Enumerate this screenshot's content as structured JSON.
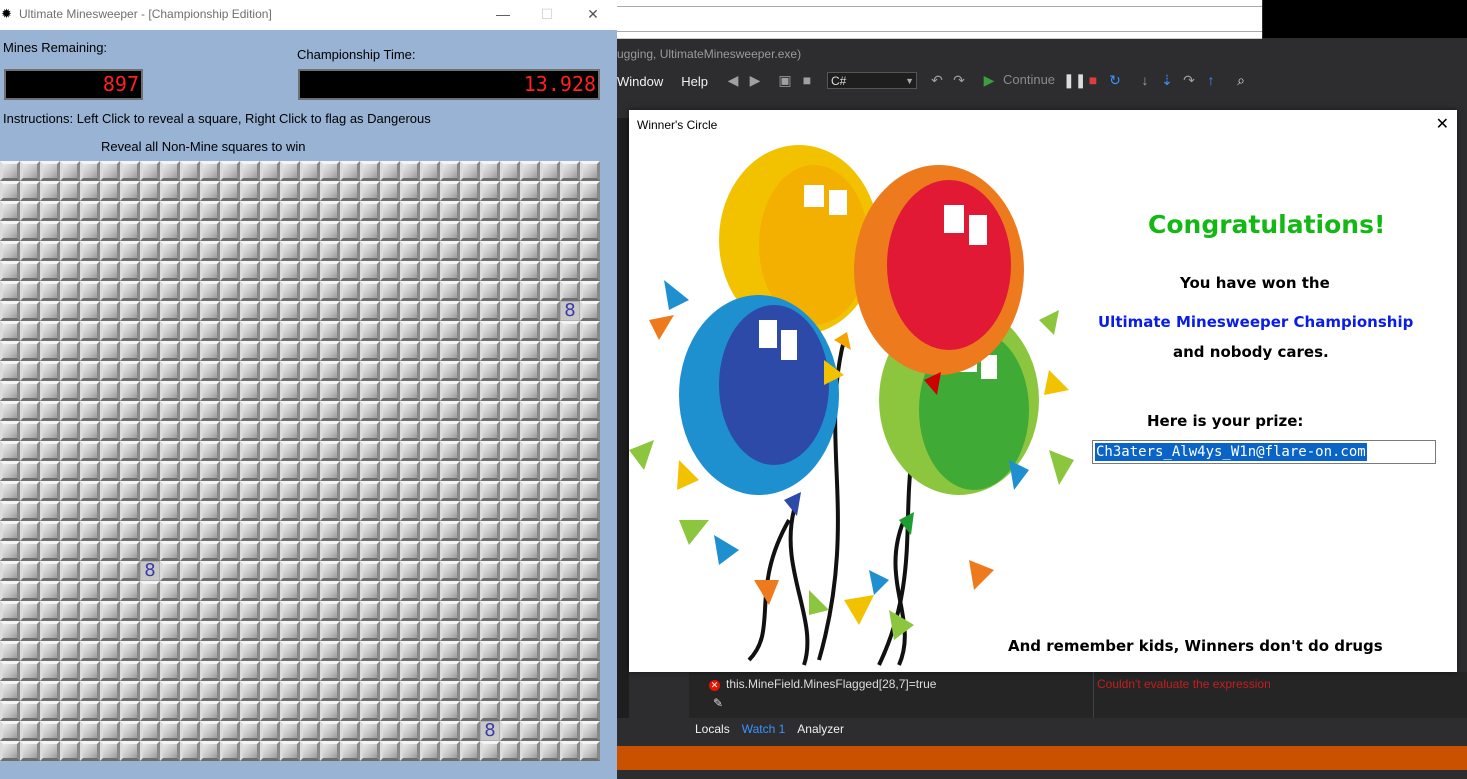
{
  "minesweeper": {
    "title": "Ultimate Minesweeper - [Championship Edition]",
    "mines_label": "Mines Remaining:",
    "mines_value": "897",
    "time_label": "Championship Time:",
    "time_value": "13.928",
    "instructions": "Instructions: Left Click to reveal a square, Right Click to flag as Dangerous",
    "goal": "Reveal all Non-Mine squares to win",
    "grid": {
      "rows": 30,
      "cols": 30,
      "revealed": [
        {
          "row": 7,
          "col": 28,
          "value": "8"
        },
        {
          "row": 20,
          "col": 7,
          "value": "8"
        },
        {
          "row": 28,
          "col": 24,
          "value": "8"
        }
      ]
    },
    "caption_buttons": {
      "minimize": "—",
      "maximize": "☐",
      "close": "✕"
    }
  },
  "vs": {
    "title_fragment": "ugging, UltimateMinesweeper.exe)",
    "menu": [
      "Window",
      "Help"
    ],
    "language": "C#",
    "continue_label": "Continue",
    "watch_row": "this.MineField.MinesFlagged[28,7]=true",
    "watch_error": "Couldn't evaluate the expression",
    "bottom_tabs": [
      "Locals",
      "Watch 1",
      "Analyzer"
    ]
  },
  "dialog": {
    "title": "Winner's Circle",
    "close": "✕",
    "congrats": "Congratulations!",
    "line1": "You have won the",
    "line2": "Ultimate Minesweeper Championship",
    "line3": "and nobody cares.",
    "prize_label": "Here is your prize:",
    "prize_value": "Ch3aters_Alw4ys_W1n@flare-on.com",
    "footer": "And remember kids, Winners don't do drugs",
    "colors": {
      "congrats": "#14b814",
      "championship": "#0a1ce8",
      "selection": "#0a64c8"
    }
  }
}
